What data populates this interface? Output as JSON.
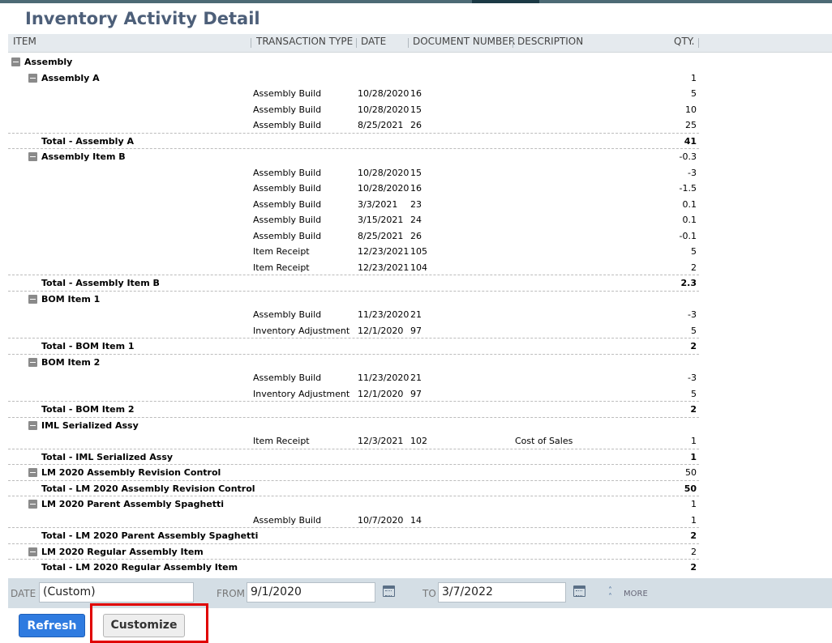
{
  "page": {
    "title": "Inventory Activity Detail"
  },
  "columns": {
    "item": "ITEM",
    "transaction_type": "TRANSACTION TYPE",
    "date": "DATE",
    "document_number": "DOCUMENT NUMBER",
    "description": "DESCRIPTION",
    "qty": "QTY."
  },
  "rows": [
    {
      "kind": "group",
      "level": 0,
      "label": "Assembly",
      "qty": ""
    },
    {
      "kind": "group",
      "level": 1,
      "label": "Assembly A",
      "qty": "1"
    },
    {
      "kind": "detail",
      "type": "Assembly Build",
      "date": "10/28/2020",
      "doc": "16",
      "desc": "",
      "qty": "5"
    },
    {
      "kind": "detail",
      "type": "Assembly Build",
      "date": "10/28/2020",
      "doc": "15",
      "desc": "",
      "qty": "10"
    },
    {
      "kind": "detail",
      "type": "Assembly Build",
      "date": "8/25/2021",
      "doc": "26",
      "desc": "",
      "qty": "25"
    },
    {
      "kind": "total",
      "label": "Total - Assembly A",
      "qty": "41"
    },
    {
      "kind": "group",
      "level": 1,
      "label": "Assembly Item B",
      "qty": "-0.3"
    },
    {
      "kind": "detail",
      "type": "Assembly Build",
      "date": "10/28/2020",
      "doc": "15",
      "desc": "",
      "qty": "-3"
    },
    {
      "kind": "detail",
      "type": "Assembly Build",
      "date": "10/28/2020",
      "doc": "16",
      "desc": "",
      "qty": "-1.5"
    },
    {
      "kind": "detail",
      "type": "Assembly Build",
      "date": "3/3/2021",
      "doc": "23",
      "desc": "",
      "qty": "0.1"
    },
    {
      "kind": "detail",
      "type": "Assembly Build",
      "date": "3/15/2021",
      "doc": "24",
      "desc": "",
      "qty": "0.1"
    },
    {
      "kind": "detail",
      "type": "Assembly Build",
      "date": "8/25/2021",
      "doc": "26",
      "desc": "",
      "qty": "-0.1"
    },
    {
      "kind": "detail",
      "type": "Item Receipt",
      "date": "12/23/2021",
      "doc": "105",
      "desc": "",
      "qty": "5"
    },
    {
      "kind": "detail",
      "type": "Item Receipt",
      "date": "12/23/2021",
      "doc": "104",
      "desc": "",
      "qty": "2"
    },
    {
      "kind": "total",
      "label": "Total - Assembly Item B",
      "qty": "2.3"
    },
    {
      "kind": "group",
      "level": 1,
      "label": "BOM Item 1",
      "qty": ""
    },
    {
      "kind": "detail",
      "type": "Assembly Build",
      "date": "11/23/2020",
      "doc": "21",
      "desc": "",
      "qty": "-3"
    },
    {
      "kind": "detail",
      "type": "Inventory Adjustment",
      "date": "12/1/2020",
      "doc": "97",
      "desc": "",
      "qty": "5"
    },
    {
      "kind": "total",
      "label": "Total - BOM Item 1",
      "qty": "2"
    },
    {
      "kind": "group",
      "level": 1,
      "label": "BOM Item 2",
      "qty": ""
    },
    {
      "kind": "detail",
      "type": "Assembly Build",
      "date": "11/23/2020",
      "doc": "21",
      "desc": "",
      "qty": "-3"
    },
    {
      "kind": "detail",
      "type": "Inventory Adjustment",
      "date": "12/1/2020",
      "doc": "97",
      "desc": "",
      "qty": "5"
    },
    {
      "kind": "total",
      "label": "Total - BOM Item 2",
      "qty": "2"
    },
    {
      "kind": "group",
      "level": 1,
      "label": "IML Serialized Assy",
      "qty": ""
    },
    {
      "kind": "detail",
      "type": "Item Receipt",
      "date": "12/3/2021",
      "doc": "102",
      "desc": "Cost of Sales",
      "qty": "1"
    },
    {
      "kind": "total",
      "label": "Total - IML Serialized Assy",
      "qty": "1"
    },
    {
      "kind": "group",
      "level": 1,
      "label": "LM 2020 Assembly Revision Control",
      "qty": "50"
    },
    {
      "kind": "total",
      "label": "Total - LM 2020 Assembly Revision Control",
      "qty": "50"
    },
    {
      "kind": "group",
      "level": 1,
      "label": "LM 2020 Parent Assembly Spaghetti",
      "qty": "1"
    },
    {
      "kind": "detail",
      "type": "Assembly Build",
      "date": "10/7/2020",
      "doc": "14",
      "desc": "",
      "qty": "1"
    },
    {
      "kind": "total",
      "label": "Total - LM 2020 Parent Assembly Spaghetti",
      "qty": "2"
    },
    {
      "kind": "group",
      "level": 1,
      "label": "LM 2020 Regular Assembly Item",
      "qty": "2"
    },
    {
      "kind": "total",
      "label": "Total - LM 2020 Regular Assembly Item",
      "qty": "2"
    }
  ],
  "filters": {
    "date_label": "DATE",
    "date_value": "(Custom)",
    "from_label": "FROM",
    "from_value": "9/1/2020",
    "to_label": "TO",
    "to_value": "3/7/2022",
    "more_label": "MORE"
  },
  "buttons": {
    "refresh": "Refresh",
    "customize": "Customize"
  },
  "colors": {
    "accent": "#2f7be0",
    "title": "#4d5f79",
    "highlight": "#e00000",
    "header_bg": "#e5eaee",
    "filter_bg": "#d4dee5"
  },
  "icons": {
    "expand": "minus-square-icon",
    "calendar": "calendar-icon",
    "more": "double-chevron-up-icon"
  }
}
